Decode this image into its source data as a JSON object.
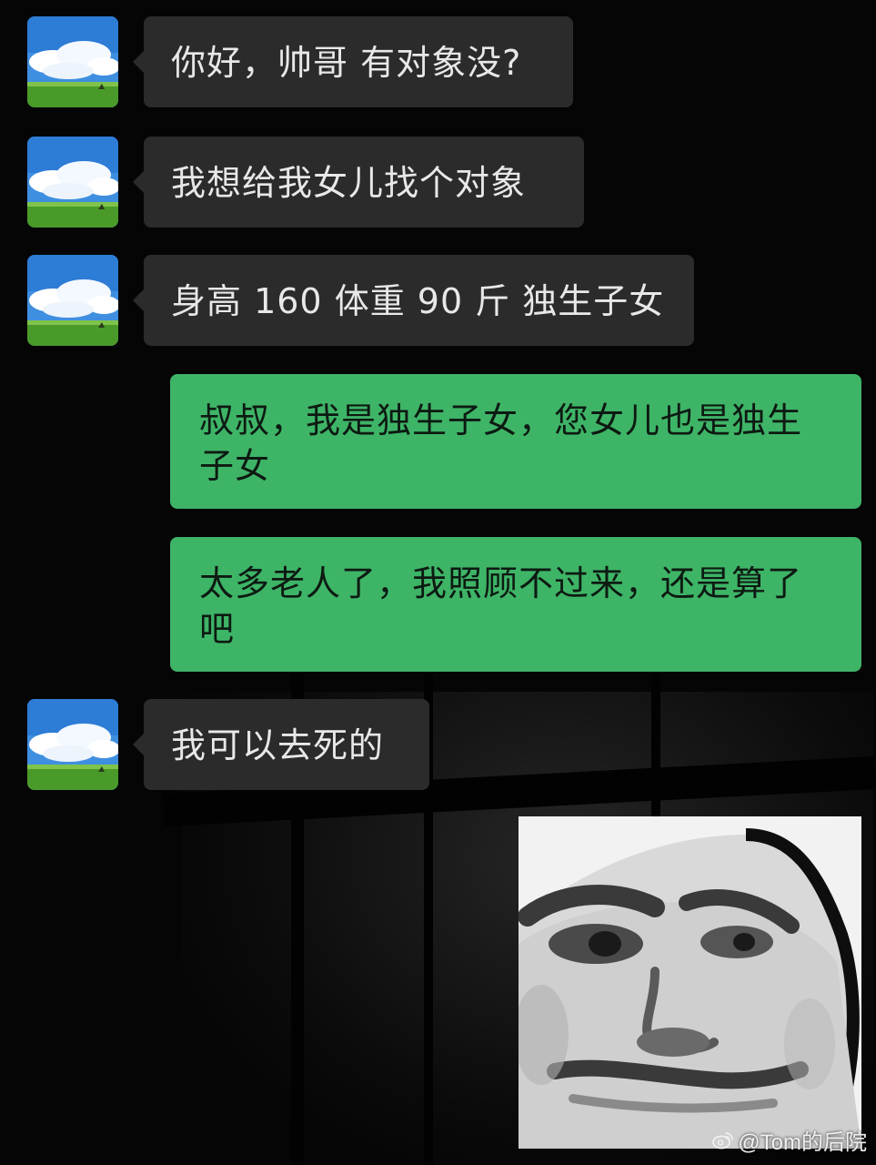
{
  "conversation": {
    "messages": [
      {
        "side": "left",
        "text": "你好，帅哥 有对象没?"
      },
      {
        "side": "left",
        "text": "我想给我女儿找个对象"
      },
      {
        "side": "left",
        "text": "身高 160 体重 90 斤 独生子女"
      },
      {
        "side": "right",
        "text": "叔叔，我是独生子女，您女儿也是独生子女"
      },
      {
        "side": "right",
        "text": "太多老人了，我照顾不过来，还是算了吧"
      },
      {
        "side": "left",
        "text": "我可以去死的"
      }
    ],
    "sticker": {
      "icon": "meme-face-sticker"
    }
  },
  "watermark": {
    "icon": "weibo-logo-icon",
    "text": "@Tom的后院"
  },
  "colors": {
    "background": "#050505",
    "incoming_bubble": "#2b2b2b",
    "outgoing_bubble": "#3eb467",
    "incoming_text": "#e8e8e8",
    "outgoing_text": "#0d1a12"
  }
}
